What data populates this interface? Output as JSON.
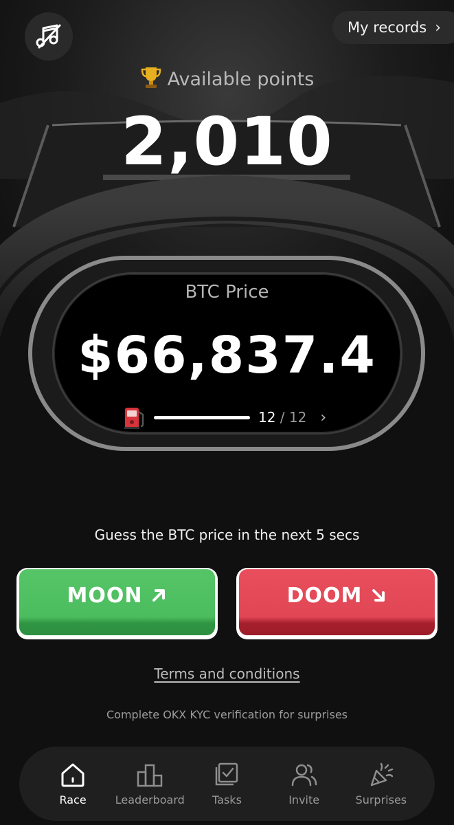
{
  "header": {
    "music_icon": "music-off-icon",
    "records_label": "My records",
    "records_chevron": "›"
  },
  "points": {
    "label": "Available points",
    "value": "2,010"
  },
  "price_panel": {
    "label": "BTC Price",
    "value": "$66,837.4",
    "fuel_current": "12",
    "fuel_separator": " / ",
    "fuel_total": "12",
    "fuel_level": 1.0,
    "chevron": "›"
  },
  "prompt": "Guess the BTC price in the next 5 secs",
  "buttons": {
    "moon_label": "MOON",
    "doom_label": "DOOM",
    "moon_color": "#4cbd5e",
    "doom_color": "#e04654"
  },
  "terms_link": "Terms and conditions",
  "kyc_note": "Complete OKX KYC verification for surprises",
  "nav": {
    "items": [
      {
        "label": "Race",
        "icon": "home-icon",
        "active": true
      },
      {
        "label": "Leaderboard",
        "icon": "leaderboard-icon",
        "active": false
      },
      {
        "label": "Tasks",
        "icon": "tasks-icon",
        "active": false
      },
      {
        "label": "Invite",
        "icon": "invite-icon",
        "active": false
      },
      {
        "label": "Surprises",
        "icon": "party-popper-icon",
        "active": false
      }
    ]
  }
}
